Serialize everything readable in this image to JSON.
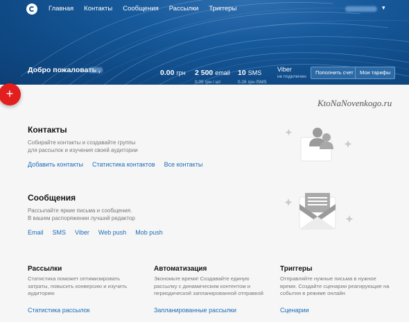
{
  "nav": {
    "links": [
      "Главная",
      "Контакты",
      "Сообщения",
      "Рассылки",
      "Триггеры"
    ],
    "user_caret": "▾"
  },
  "hero": {
    "welcome": "Добро пожаловать ,",
    "balance": {
      "value": "0.00",
      "unit": "грн"
    },
    "email": {
      "value": "2 500",
      "unit": "email",
      "sub": "0.05 грн / шт"
    },
    "sms": {
      "value": "10",
      "unit": "SMS",
      "sub": "0.26 грн /SMS"
    },
    "viber": {
      "value": "Viber",
      "sub": "не подключен"
    },
    "buttons": {
      "topup": "Пополнить счет",
      "tariffs": "Мои тарифы"
    }
  },
  "fab": {
    "label": "+"
  },
  "watermark": "KtoNaNovenkogo.ru",
  "contacts": {
    "title": "Контакты",
    "desc": [
      "Собирайте контакты и создавайте группы",
      "для рассылок и изучения своей аудитории"
    ],
    "links": [
      "Добавить контакты",
      "Статистика контактов",
      "Все контакты"
    ]
  },
  "messages": {
    "title": "Сообщения",
    "desc": [
      "Рассылайте яркие письма и сообщения.",
      "В вашем распоряжении лучший редактор"
    ],
    "links": [
      "Email",
      "SMS",
      "Viber",
      "Web push",
      "Mob push"
    ]
  },
  "columns": [
    {
      "title": "Рассылки",
      "desc": [
        "Статистика поможет оптимизировать",
        "затраты, повысить конверсию и изучить",
        "аудиторию"
      ],
      "link": "Статистика рассылок"
    },
    {
      "title": "Автоматизация",
      "desc": [
        "Экономьте время! Создавайте единую",
        "рассылку с динамическим контентом и",
        "периодической запланированной отправкой"
      ],
      "link": "Запланированные рассылки"
    },
    {
      "title": "Триггеры",
      "desc": [
        "Отправляйте нужные письма в нужное",
        "время. Создайте сценарии реагирующие на",
        "события в режиме онлайн"
      ],
      "link": "Сценарии"
    }
  ],
  "colors": {
    "accent": "#1c6bb8",
    "hero": "#175a9c",
    "fab": "#e21e1e"
  }
}
